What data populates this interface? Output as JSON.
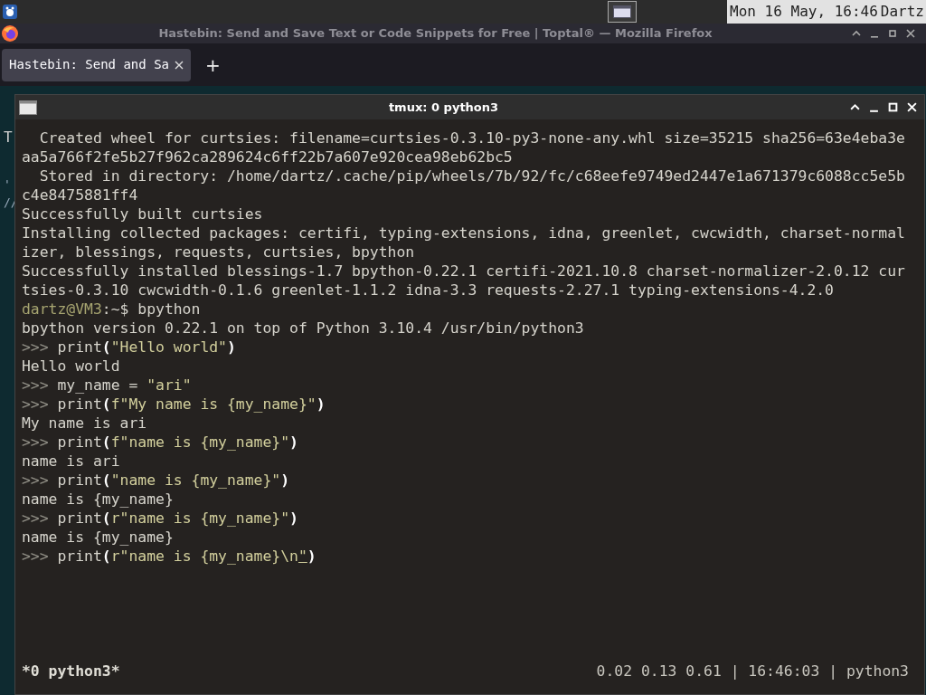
{
  "top_panel": {
    "clock": "Mon 16 May, 16:46",
    "user": "Dartz"
  },
  "browser": {
    "title": "Hastebin: Send and Save Text or Code Snippets for Free | Toptal® — Mozilla Firefox",
    "tabs": [
      {
        "label": "Hastebin: Send and Sa",
        "selected": true
      }
    ],
    "new_tab": "+",
    "behind_text": [
      "T",
      "'",
      "//"
    ]
  },
  "terminal": {
    "title": "tmux: 0 python3",
    "lines": [
      [
        {
          "text": "  Created wheel for curtsies: filename=curtsies-0.3.10-py3-none-any.whl size=35215 sha256=63e4eba3e",
          "kind": "output"
        }
      ],
      [
        {
          "text": "aa5a766f2fe5b27f962ca289624c6ff22b7a607e920cea98eb62bc5",
          "kind": "output"
        }
      ],
      [
        {
          "text": "  Stored in directory: /home/dartz/.cache/pip/wheels/7b/92/fc/c68eefe9749ed2447e1a671379c6088cc5e5b",
          "kind": "output"
        }
      ],
      [
        {
          "text": "c4e8475881ff4",
          "kind": "output"
        }
      ],
      [
        {
          "text": "Successfully built curtsies",
          "kind": "output"
        }
      ],
      [
        {
          "text": "Installing collected packages: certifi, typing-extensions, idna, greenlet, cwcwidth, charset-normal",
          "kind": "output"
        }
      ],
      [
        {
          "text": "izer, blessings, requests, curtsies, bpython",
          "kind": "output"
        }
      ],
      [
        {
          "text": "Successfully installed blessings-1.7 bpython-0.22.1 certifi-2021.10.8 charset-normalizer-2.0.12 cur",
          "kind": "output"
        }
      ],
      [
        {
          "text": "tsies-0.3.10 cwcwidth-0.1.6 greenlet-1.1.2 idna-3.3 requests-2.27.1 typing-extensions-4.2.0",
          "kind": "output"
        }
      ],
      [
        {
          "text": "dartz@VM3",
          "kind": "user"
        },
        {
          "text": ":~$ bpython",
          "kind": "output"
        }
      ],
      [
        {
          "text": "bpython version 0.22.1 on top of Python 3.10.4 /usr/bin/python3",
          "kind": "output"
        }
      ],
      [
        {
          "text": ">>> ",
          "kind": "prompt"
        },
        {
          "text": "print",
          "kind": "code"
        },
        {
          "text": "(",
          "kind": "paren"
        },
        {
          "text": "\"Hello world\"",
          "kind": "string"
        },
        {
          "text": ")",
          "kind": "paren"
        }
      ],
      [
        {
          "text": "Hello world",
          "kind": "output"
        }
      ],
      [
        {
          "text": ">>> ",
          "kind": "prompt"
        },
        {
          "text": "my_name = ",
          "kind": "code"
        },
        {
          "text": "\"ari\"",
          "kind": "string"
        }
      ],
      [
        {
          "text": ">>> ",
          "kind": "prompt"
        },
        {
          "text": "print",
          "kind": "code"
        },
        {
          "text": "(",
          "kind": "paren"
        },
        {
          "text": "f\"My name is {my_name}\"",
          "kind": "string"
        },
        {
          "text": ")",
          "kind": "paren"
        }
      ],
      [
        {
          "text": "My name is ari",
          "kind": "output"
        }
      ],
      [
        {
          "text": ">>> ",
          "kind": "prompt"
        },
        {
          "text": "print",
          "kind": "code"
        },
        {
          "text": "(",
          "kind": "paren"
        },
        {
          "text": "f\"name is {my_name}\"",
          "kind": "string"
        },
        {
          "text": ")",
          "kind": "paren"
        }
      ],
      [
        {
          "text": "name is ari",
          "kind": "output"
        }
      ],
      [
        {
          "text": ">>> ",
          "kind": "prompt"
        },
        {
          "text": "print",
          "kind": "code"
        },
        {
          "text": "(",
          "kind": "paren"
        },
        {
          "text": "\"name is {my_name}\"",
          "kind": "string"
        },
        {
          "text": ")",
          "kind": "paren"
        }
      ],
      [
        {
          "text": "name is {my_name}",
          "kind": "output"
        }
      ],
      [
        {
          "text": ">>> ",
          "kind": "prompt"
        },
        {
          "text": "print",
          "kind": "code"
        },
        {
          "text": "(",
          "kind": "paren"
        },
        {
          "text": "r\"name is {my_name}\"",
          "kind": "string"
        },
        {
          "text": ")",
          "kind": "paren"
        }
      ],
      [
        {
          "text": "name is {my_name}",
          "kind": "output"
        }
      ],
      [
        {
          "text": ">>> ",
          "kind": "prompt"
        },
        {
          "text": "print",
          "kind": "code"
        },
        {
          "text": "(",
          "kind": "paren"
        },
        {
          "text": "r\"name is {my_name}\\n",
          "kind": "string"
        },
        {
          "text": "\"",
          "kind": "cursor"
        },
        {
          "text": ")",
          "kind": "paren"
        }
      ]
    ],
    "status_left": "*0 python3*",
    "status_right": "0.02 0.13 0.61 | 16:46:03 | python3"
  }
}
